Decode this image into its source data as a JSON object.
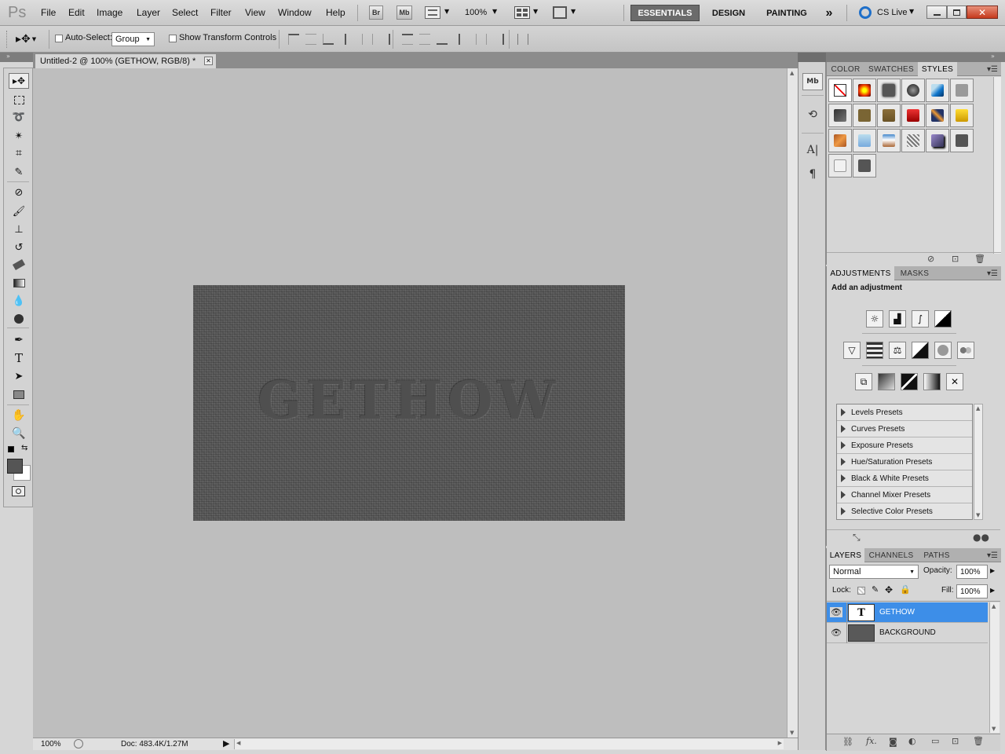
{
  "app": {
    "logo": "Ps",
    "menus": [
      "File",
      "Edit",
      "Image",
      "Layer",
      "Select",
      "Filter",
      "View",
      "Window",
      "Help"
    ],
    "bridge_btn": "Br",
    "minibridge_btn": "Mb",
    "zoom": "100%",
    "workspaces": [
      "ESSENTIALS",
      "DESIGN",
      "PAINTING"
    ],
    "more_workspaces": "»",
    "cs_live": "CS Live"
  },
  "options": {
    "auto_select_label": "Auto-Select:",
    "auto_select_value": "Group",
    "show_transform_label": "Show Transform Controls"
  },
  "document": {
    "tab_title": "Untitled-2 @ 100% (GETHOW, RGB/8) *",
    "canvas_text": "GETHOW",
    "status_zoom": "100%",
    "status_doc": "Doc: 483.4K/1.27M",
    "colors": {
      "canvas": "#595959",
      "workspace": "#bebebe"
    }
  },
  "styles_panel": {
    "tabs": [
      "COLOR",
      "SWATCHES",
      "STYLES"
    ],
    "active_tab": "STYLES"
  },
  "adjustments_panel": {
    "tabs": [
      "ADJUSTMENTS",
      "MASKS"
    ],
    "heading": "Add an adjustment",
    "presets": [
      "Levels Presets",
      "Curves Presets",
      "Exposure Presets",
      "Hue/Saturation Presets",
      "Black & White Presets",
      "Channel Mixer Presets",
      "Selective Color Presets"
    ]
  },
  "layers_panel": {
    "tabs": [
      "LAYERS",
      "CHANNELS",
      "PATHS"
    ],
    "blend_mode": "Normal",
    "opacity_label": "Opacity:",
    "opacity_value": "100%",
    "lock_label": "Lock:",
    "fill_label": "Fill:",
    "fill_value": "100%",
    "layers": [
      {
        "name": "GETHOW",
        "thumb": "T",
        "selected": true
      },
      {
        "name": "BACKGROUND",
        "thumb": "",
        "selected": false
      }
    ],
    "selection_color": "#3d8ee8"
  }
}
